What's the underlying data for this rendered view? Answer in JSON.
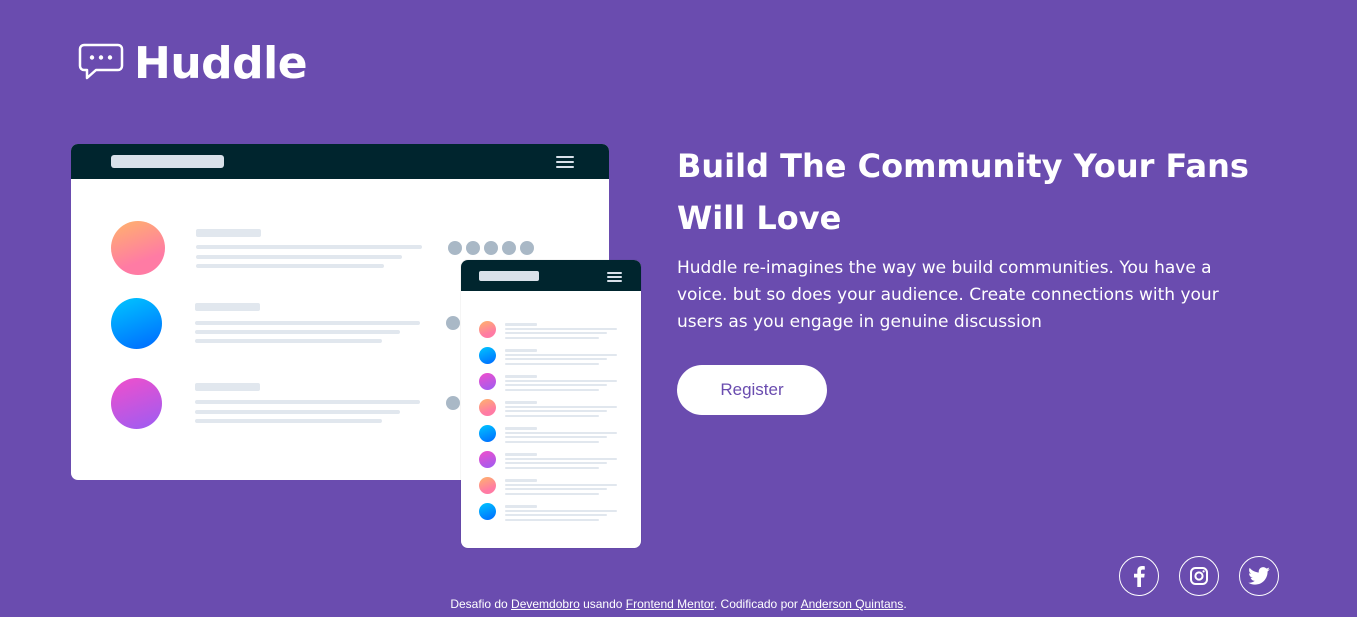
{
  "logo": {
    "text": "Huddle",
    "icon": "chat-bubble-icon"
  },
  "hero": {
    "title": "Build The Community Your Fans Will Love",
    "description": "Huddle re-imagines the way we build communities. You have a voice. but so does your audience. Create connections with your users as you engage in genuine discussion",
    "register_label": "Register"
  },
  "socials": [
    {
      "icon": "facebook-icon"
    },
    {
      "icon": "instagram-icon"
    },
    {
      "icon": "twitter-icon"
    }
  ],
  "footer": {
    "prefix": "Desafio do ",
    "link1": "Devemdobro",
    "mid1": " usando ",
    "link2": "Frontend Mentor",
    "mid2": ". Codificado por ",
    "link3": "Anderson Quintans",
    "suffix": "."
  },
  "colors": {
    "background": "#6a4caf",
    "navbar": "#00252e",
    "button_text": "#6a4caf"
  }
}
